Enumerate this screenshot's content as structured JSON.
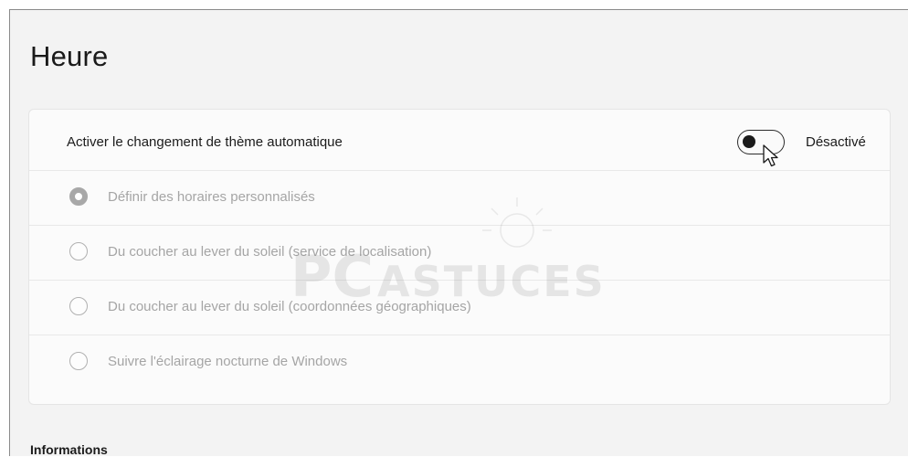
{
  "page": {
    "title": "Heure"
  },
  "auto_theme": {
    "label": "Activer le changement de thème automatique",
    "toggle_state_label": "Désactivé",
    "toggle_on": false
  },
  "options": [
    {
      "label": "Définir des horaires personnalisés",
      "checked": true
    },
    {
      "label": "Du coucher au lever du soleil (service de localisation)",
      "checked": false
    },
    {
      "label": "Du coucher au lever du soleil (coordonnées géographiques)",
      "checked": false
    },
    {
      "label": "Suivre l'éclairage nocturne de Windows",
      "checked": false
    }
  ],
  "informations": {
    "title": "Informations"
  },
  "watermark": {
    "text_pc": "PC",
    "text_astuces": "ASTUCES"
  },
  "colors": {
    "disabled_text": "#a5a5a5",
    "card_background": "#fbfbfb",
    "page_background": "#f3f3f3"
  }
}
